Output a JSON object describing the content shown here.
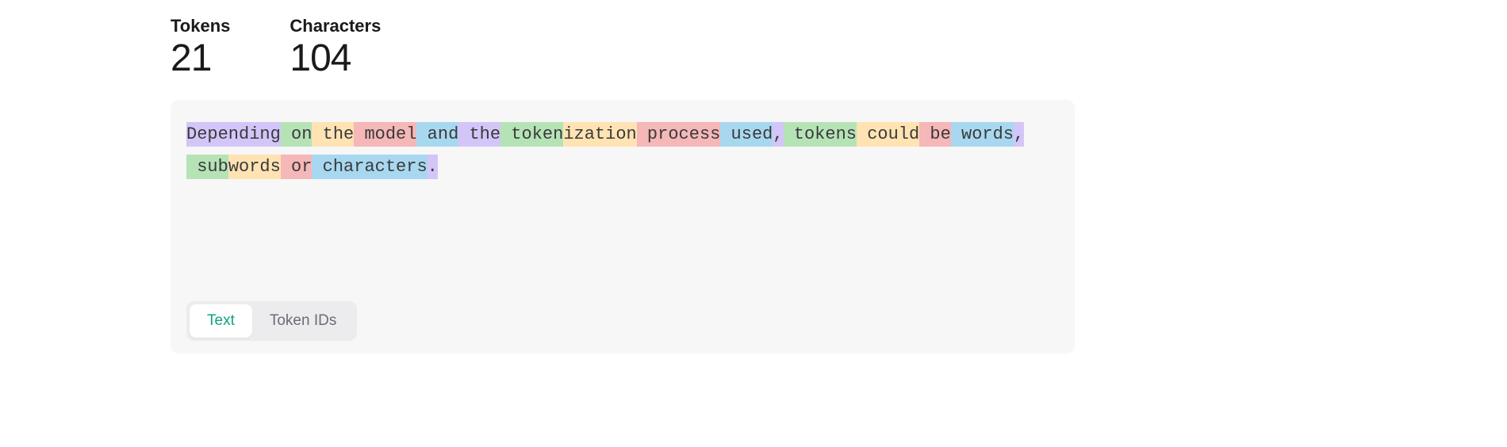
{
  "stats": {
    "tokens_label": "Tokens",
    "tokens_value": "21",
    "characters_label": "Characters",
    "characters_value": "104"
  },
  "tokens": [
    {
      "text": "Depending",
      "c": 0
    },
    {
      "text": " on",
      "c": 1
    },
    {
      "text": " the",
      "c": 2
    },
    {
      "text": " model",
      "c": 3
    },
    {
      "text": " and",
      "c": 4
    },
    {
      "text": " the",
      "c": 0
    },
    {
      "text": " token",
      "c": 1
    },
    {
      "text": "ization",
      "c": 2
    },
    {
      "text": " process",
      "c": 3
    },
    {
      "text": " used",
      "c": 4
    },
    {
      "text": ",",
      "c": 0
    },
    {
      "text": " tokens",
      "c": 1
    },
    {
      "text": " could",
      "c": 2
    },
    {
      "text": " be",
      "c": 3
    },
    {
      "text": " words",
      "c": 4
    },
    {
      "text": ",",
      "c": 0
    },
    {
      "text": " sub",
      "c": 1
    },
    {
      "text": "words",
      "c": 2
    },
    {
      "text": " or",
      "c": 3
    },
    {
      "text": " characters",
      "c": 4
    },
    {
      "text": ".",
      "c": 0
    }
  ],
  "tabs": {
    "text": "Text",
    "token_ids": "Token IDs"
  }
}
